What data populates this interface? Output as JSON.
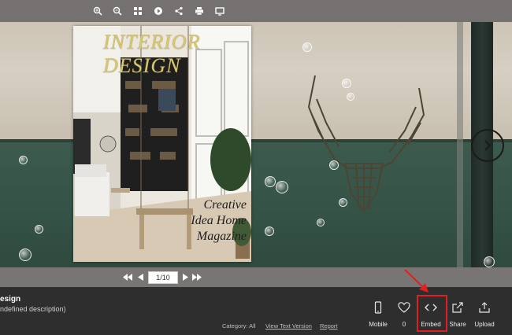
{
  "toolbar": {
    "icons": [
      "zoom-in-icon",
      "zoom-out-icon",
      "thumbnails-icon",
      "play-icon",
      "share-icon",
      "print-icon",
      "fullscreen-icon"
    ]
  },
  "magazine": {
    "title_line1": "INTERIOR",
    "title_line2": "DESIGN",
    "tagline_line1": "Creative",
    "tagline_line2": "Idea Home",
    "tagline_line3": "Magazine"
  },
  "pager": {
    "page_indicator": "1/10"
  },
  "info": {
    "title": "esign",
    "description": "ndefined description)",
    "category": "Category: All",
    "view_text": "View Text Version",
    "report": "Report"
  },
  "actions": {
    "mobile": "Mobile",
    "likes": "0",
    "embed": "Embed",
    "share": "Share",
    "upload": "Upload"
  },
  "colors": {
    "highlight": "#e02020",
    "toolbar_bg": "#767171",
    "panel_bg": "#2e2e2e",
    "wall_green": "#3c5a4d"
  }
}
